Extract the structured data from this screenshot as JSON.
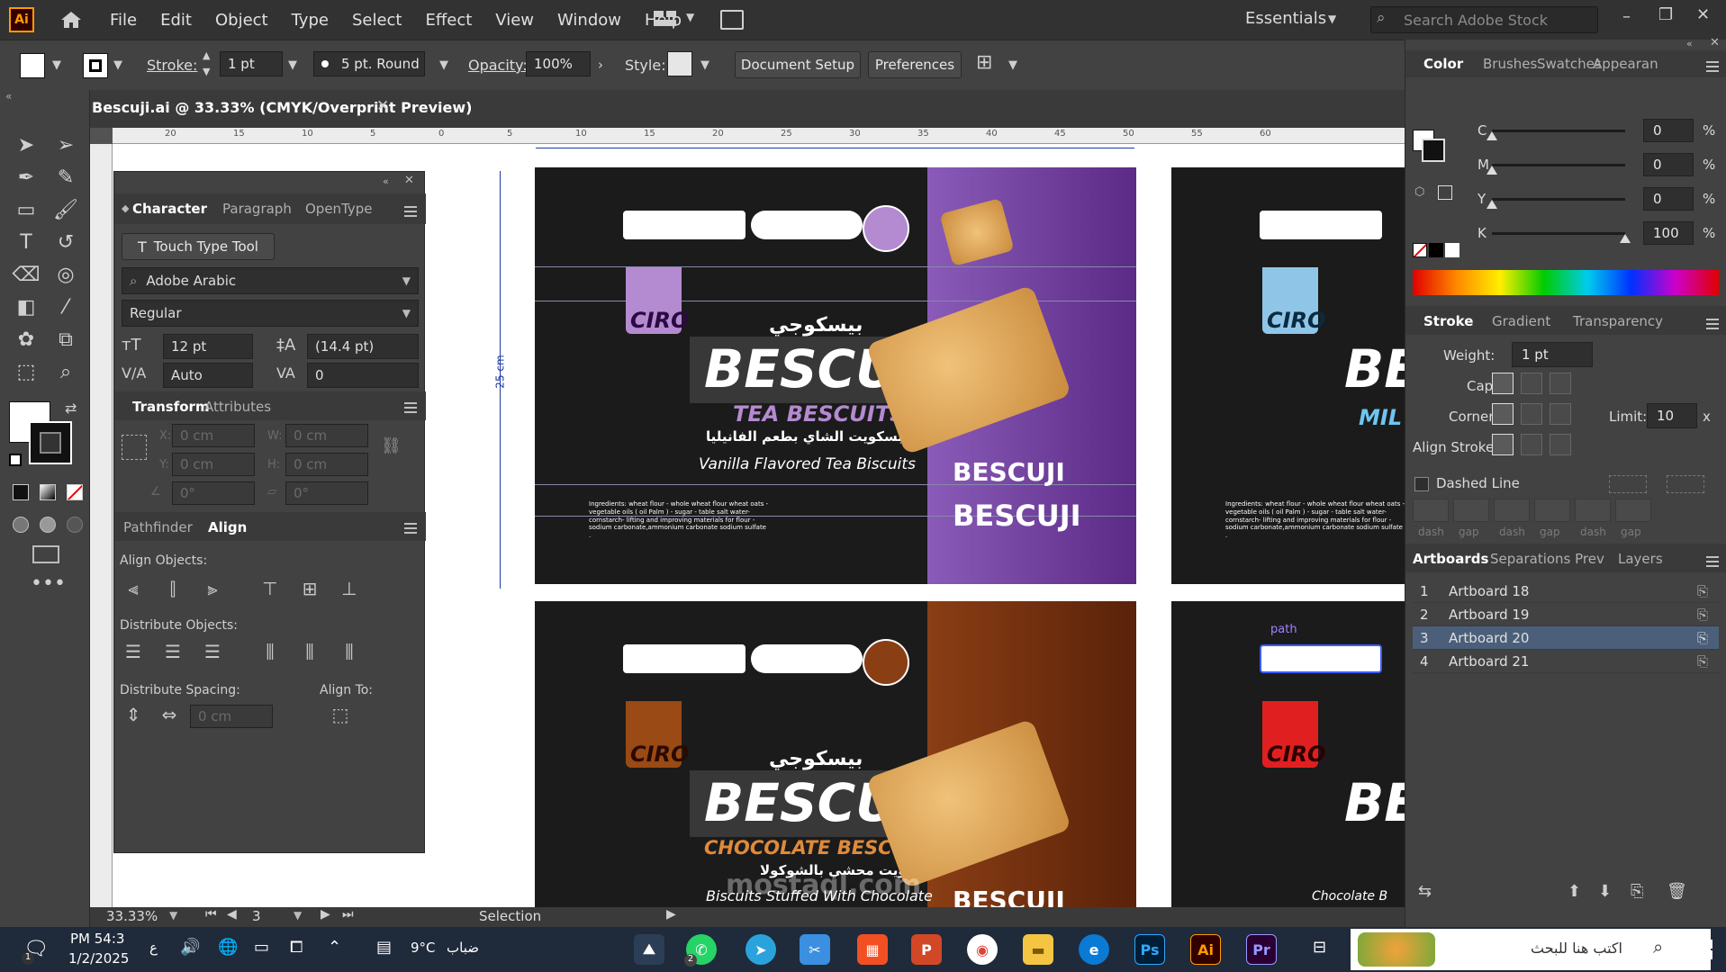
{
  "app": {
    "logo": "Ai",
    "menu": [
      "File",
      "Edit",
      "Object",
      "Type",
      "Select",
      "Effect",
      "View",
      "Window",
      "Help"
    ],
    "workspace": "Essentials",
    "search_placeholder": "Search Adobe Stock"
  },
  "control_bar": {
    "stroke_label": "Stroke:",
    "stroke_value": "1 pt",
    "brush": "5 pt. Round",
    "opacity_label": "Opacity:",
    "opacity_value": "100%",
    "style_label": "Style:",
    "document_setup": "Document Setup",
    "preferences": "Preferences"
  },
  "document": {
    "tab_title": "Bescuji.ai @ 33.33% (CMYK/Overprint Preview)",
    "dimension_label": "25 cm",
    "ruler_marks": [
      "25",
      "20",
      "15",
      "10",
      "5",
      "0",
      "5",
      "10",
      "15",
      "20",
      "25",
      "30",
      "35",
      "40",
      "45",
      "50",
      "55",
      "60"
    ]
  },
  "character_panel": {
    "tabs": [
      "Character",
      "Paragraph",
      "OpenType"
    ],
    "touch_type": "Touch Type Tool",
    "font_family": "Adobe Arabic",
    "font_style": "Regular",
    "font_size": "12 pt",
    "leading": "(14.4 pt)",
    "kerning": "Auto",
    "tracking": "0"
  },
  "transform_panel": {
    "tabs": [
      "Transform",
      "Attributes"
    ],
    "x_label": "X:",
    "x": "0 cm",
    "y_label": "Y:",
    "y": "0 cm",
    "w_label": "W:",
    "w": "0 cm",
    "h_label": "H:",
    "h": "0 cm",
    "angle": "0°",
    "shear": "0°"
  },
  "align_panel": {
    "tabs": [
      "Pathfinder",
      "Align"
    ],
    "align_objects": "Align Objects:",
    "distribute_objects": "Distribute Objects:",
    "distribute_spacing": "Distribute Spacing:",
    "align_to": "Align To:",
    "spacing_value": "0 cm"
  },
  "color_panel": {
    "tabs": [
      "Color",
      "Brushes",
      "Swatches",
      "Appearan"
    ],
    "channels": [
      {
        "label": "C",
        "value": "0",
        "pct": "%",
        "level": 0
      },
      {
        "label": "M",
        "value": "0",
        "pct": "%",
        "level": 0
      },
      {
        "label": "Y",
        "value": "0",
        "pct": "%",
        "level": 0
      },
      {
        "label": "K",
        "value": "100",
        "pct": "%",
        "level": 100
      }
    ]
  },
  "stroke_panel": {
    "tabs": [
      "Stroke",
      "Gradient",
      "Transparency"
    ],
    "weight_label": "Weight:",
    "weight": "1 pt",
    "cap_label": "Cap:",
    "corner_label": "Corner:",
    "limit_label": "Limit:",
    "limit": "10",
    "limit_unit": "x",
    "align_stroke_label": "Align Stroke:",
    "dashed_line": "Dashed Line",
    "dash_labels": [
      "dash",
      "gap",
      "dash",
      "gap",
      "dash",
      "gap"
    ]
  },
  "artboards_panel": {
    "tabs": [
      "Artboards",
      "Separations Prev",
      "Layers"
    ],
    "rows": [
      {
        "num": "1",
        "name": "Artboard 18"
      },
      {
        "num": "2",
        "name": "Artboard 19"
      },
      {
        "num": "3",
        "name": "Artboard 20"
      },
      {
        "num": "4",
        "name": "Artboard 21"
      }
    ],
    "selected_index": 2
  },
  "status_bar": {
    "zoom": "33.33%",
    "artboard": "3",
    "tool": "Selection"
  },
  "packaging": {
    "brand": "BESCUJI",
    "brand_ar": "بيسكوجي",
    "ciro": "CIRO",
    "tea_title": "TEA BESCUITS",
    "tea_ar": "بسكويت الشاي بطعم الفانيليا",
    "tea_sub": "Vanilla Flavored Tea Biscuits",
    "choc_title": "CHOCOLATE BESCUITS",
    "choc_ar": "بسكويت محشي بالشوكولا",
    "choc_sub": "Biscuits Stuffed With Chocolate",
    "ingredients": "Ingredients: wheat flour - whole wheat flour wheat oats - vegetable oils ( oil Palm ) - sugar - table salt water-cornstarch- lifting and improving materials for flour -sodium carbonate,ammonium carbonate sodium sulfate .",
    "path_label": "path",
    "milk_partial": "MIL",
    "choc_partial": "Chocolate B",
    "watermark": "mostaql.com"
  },
  "taskbar": {
    "time": "PM 54:3",
    "date": "1/2/2025",
    "lang": "ع",
    "weather": "9°C",
    "weather_text": "ضباب",
    "search": "اكتب هنا للبحث",
    "badge": "2",
    "notif": "1"
  },
  "colors": {
    "purple": "#5b2a86",
    "brown": "#6a2e0c",
    "accent_orange": "#ff9a00",
    "selection_blue": "#4b5f7a"
  }
}
